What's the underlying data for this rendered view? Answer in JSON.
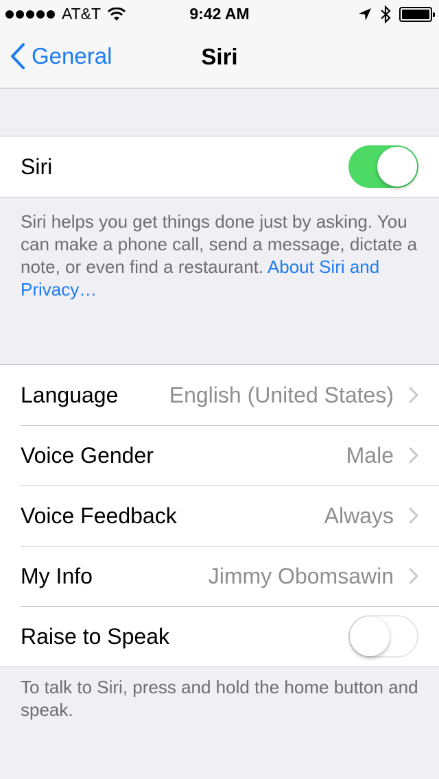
{
  "status_bar": {
    "carrier": "AT&T",
    "time": "9:42 AM",
    "signal_icon": "signal-dots-icon",
    "wifi_icon": "wifi-icon",
    "location_icon": "location-arrow-icon",
    "bluetooth_icon": "bluetooth-icon",
    "battery_icon": "battery-icon",
    "battery_level": 1.0
  },
  "nav": {
    "back_label": "General",
    "title": "Siri"
  },
  "siri_toggle": {
    "label": "Siri",
    "on": true
  },
  "siri_description": {
    "text": "Siri helps you get things done just by asking. You can make a phone call, send a message, dictate a note, or even find a restaurant. ",
    "link": "About Siri and Privacy…"
  },
  "settings": [
    {
      "label": "Language",
      "value": "English (United States)"
    },
    {
      "label": "Voice Gender",
      "value": "Male"
    },
    {
      "label": "Voice Feedback",
      "value": "Always"
    },
    {
      "label": "My Info",
      "value": "Jimmy Obomsawin"
    }
  ],
  "raise_to_speak": {
    "label": "Raise to Speak",
    "on": false
  },
  "footer_note": "To talk to Siri, press and hold the home button and speak.",
  "colors": {
    "accent": "#1d7cf2",
    "toggle_on": "#4cd964",
    "background": "#efeff4",
    "secondary_text": "#8e8e93"
  }
}
